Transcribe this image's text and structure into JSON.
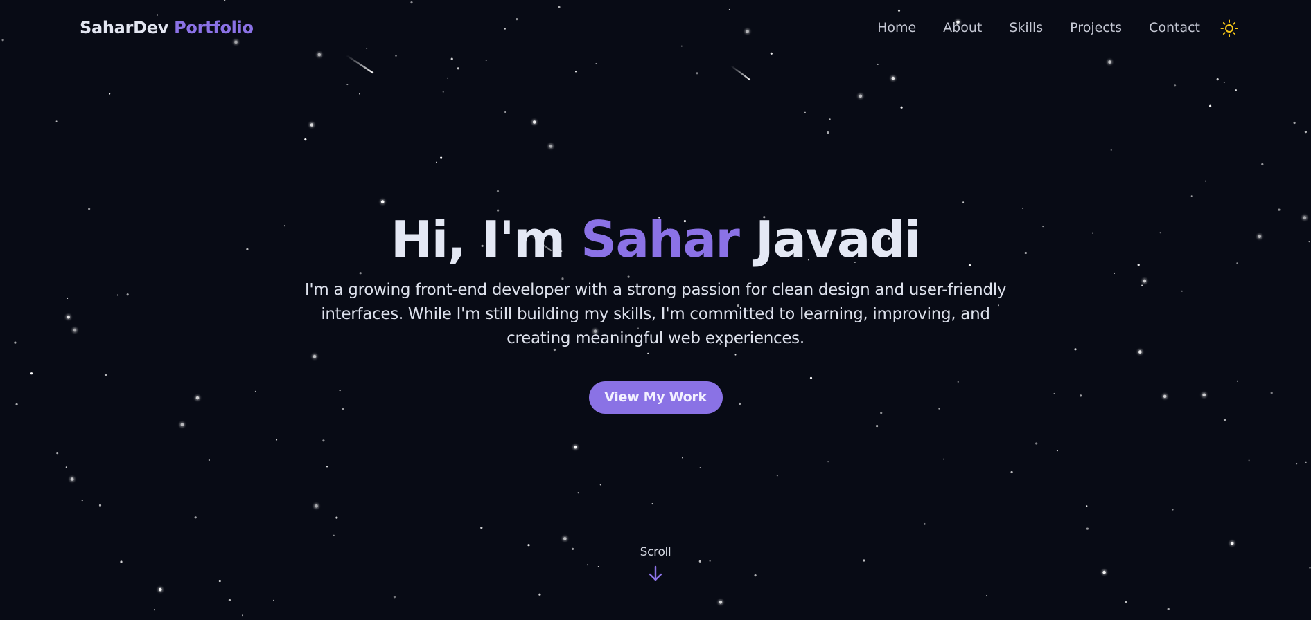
{
  "navbar": {
    "logo_main": "SaharDev",
    "logo_accent": "Portfolio",
    "links": [
      "Home",
      "About",
      "Skills",
      "Projects",
      "Contact"
    ],
    "theme_icon": "sun-icon"
  },
  "hero": {
    "greeting": "Hi, I'm",
    "first_name": "Sahar",
    "last_name": "Javadi",
    "description": "I'm a growing front-end developer with a strong passion for clean design and user-friendly interfaces. While I'm still building my skills, I'm committed to learning, improving, and creating meaningful web experiences.",
    "cta_label": "View My Work"
  },
  "scroll": {
    "label": "Scroll",
    "icon": "arrow-down-icon"
  },
  "colors": {
    "background": "#080b15",
    "accent": "#8b72e6",
    "text": "#e4e8f4",
    "muted_text": "#c5c8d4",
    "sun": "#f5c518"
  }
}
